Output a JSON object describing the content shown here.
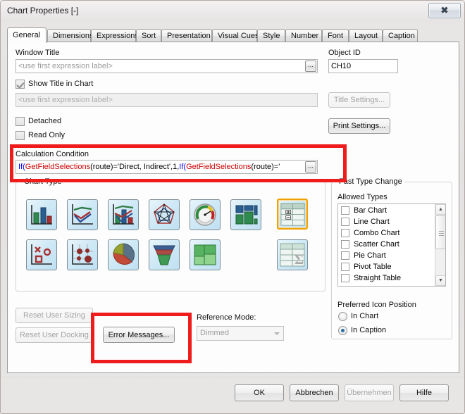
{
  "window": {
    "title": "Chart Properties [-]",
    "close_label": "✕"
  },
  "tabs": [
    {
      "label": "General",
      "active": true
    },
    {
      "label": "Dimensions",
      "active": false
    },
    {
      "label": "Expressions",
      "active": false
    },
    {
      "label": "Sort",
      "active": false
    },
    {
      "label": "Presentation",
      "active": false
    },
    {
      "label": "Visual Cues",
      "active": false
    },
    {
      "label": "Style",
      "active": false
    },
    {
      "label": "Number",
      "active": false
    },
    {
      "label": "Font",
      "active": false
    },
    {
      "label": "Layout",
      "active": false
    },
    {
      "label": "Caption",
      "active": false
    }
  ],
  "general": {
    "window_title_label": "Window Title",
    "window_title_value": "",
    "window_title_placeholder": "<use first expression label>",
    "window_title_browse": "...",
    "object_id_label": "Object ID",
    "object_id_value": "CH10",
    "show_title_label": "Show Title in Chart",
    "show_title_checked": true,
    "chart_title_placeholder": "<use first expression label>",
    "title_settings_label": "Title Settings...",
    "detached_label": "Detached",
    "detached_checked": false,
    "read_only_label": "Read Only",
    "read_only_checked": false,
    "print_settings_label": "Print Settings...",
    "calc_condition_label": "Calculation Condition",
    "calc_condition_tokens": [
      {
        "t": "If(",
        "c": "fx-b"
      },
      {
        "t": "GetFieldSelections",
        "c": "fx-r"
      },
      {
        "t": "(route)='Direct, Indirect',1,",
        "c": "fx-k"
      },
      {
        "t": "If(",
        "c": "fx-b"
      },
      {
        "t": "GetFieldSelections",
        "c": "fx-r"
      },
      {
        "t": "(route)='",
        "c": "fx-k"
      }
    ],
    "calc_condition_text": "If(GetFieldSelections(route)='Direct, Indirect',1,If(GetFieldSelections(route)='",
    "calc_condition_browse": "..."
  },
  "chart_type": {
    "group_label": "Chart Type",
    "icons": [
      {
        "name": "bar-chart-icon",
        "row": 0,
        "col": 0,
        "selected": false
      },
      {
        "name": "line-chart-icon",
        "row": 0,
        "col": 1,
        "selected": false
      },
      {
        "name": "combo-chart-icon",
        "row": 0,
        "col": 2,
        "selected": false
      },
      {
        "name": "radar-chart-icon",
        "row": 0,
        "col": 3,
        "selected": false
      },
      {
        "name": "gauge-chart-icon",
        "row": 0,
        "col": 4,
        "selected": false
      },
      {
        "name": "block-chart-icon",
        "row": 0,
        "col": 5,
        "selected": false
      },
      {
        "name": "pivot-table-icon",
        "row": 0,
        "col": 6,
        "selected": true
      },
      {
        "name": "scatter-chart-icon",
        "row": 1,
        "col": 0,
        "selected": false
      },
      {
        "name": "grid-chart-icon",
        "row": 1,
        "col": 1,
        "selected": false
      },
      {
        "name": "pie-chart-icon",
        "row": 1,
        "col": 2,
        "selected": false
      },
      {
        "name": "funnel-chart-icon",
        "row": 1,
        "col": 3,
        "selected": false
      },
      {
        "name": "mekko-chart-icon",
        "row": 1,
        "col": 4,
        "selected": false
      },
      {
        "name": "straight-table-icon",
        "row": 1,
        "col": 6,
        "selected": false
      }
    ]
  },
  "fast_type_change": {
    "group_label": "Fast Type Change",
    "allowed_types_label": "Allowed Types",
    "items": [
      {
        "label": "Bar Chart",
        "checked": false
      },
      {
        "label": "Line Chart",
        "checked": false
      },
      {
        "label": "Combo Chart",
        "checked": false
      },
      {
        "label": "Scatter Chart",
        "checked": false
      },
      {
        "label": "Pie Chart",
        "checked": false
      },
      {
        "label": "Pivot Table",
        "checked": false
      },
      {
        "label": "Straight Table",
        "checked": false
      }
    ],
    "scroll_up": "▲",
    "scroll_down": "▼"
  },
  "icon_position": {
    "label": "Preferred Icon Position",
    "options": [
      {
        "label": "In Chart",
        "selected": false
      },
      {
        "label": "In Caption",
        "selected": true
      }
    ]
  },
  "lower": {
    "reset_user_sizing_label": "Reset User Sizing",
    "reset_user_docking_label": "Reset User Docking",
    "error_messages_label": "Error Messages...",
    "reference_mode_label": "Reference Mode:",
    "reference_mode_value": "Dimmed"
  },
  "footer": {
    "ok_label": "OK",
    "cancel_label": "Abbrechen",
    "apply_label": "Übernehmen",
    "help_label": "Hilfe"
  },
  "annotations": {
    "color": "#ee1c1c",
    "boxes": [
      {
        "name": "calculation-condition-highlight"
      },
      {
        "name": "error-messages-highlight"
      }
    ]
  }
}
